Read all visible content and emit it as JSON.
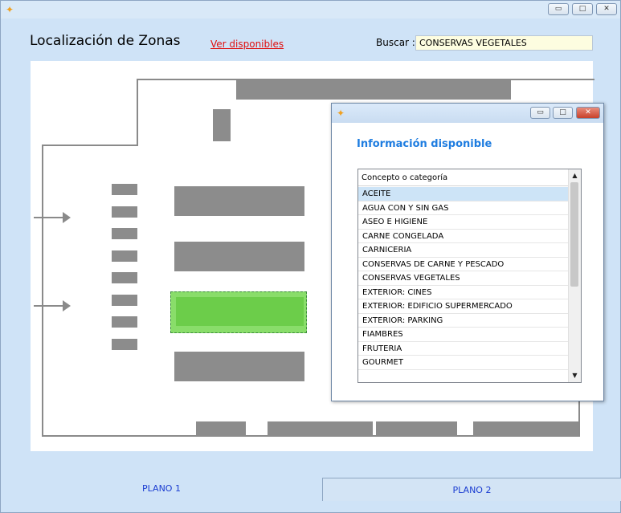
{
  "window": {
    "app_icon": "logo-bird-icon",
    "minimize": "▭",
    "maximize": "□",
    "close": "✕"
  },
  "header": {
    "title": "Localización de Zonas",
    "link_label": "Ver disponibles",
    "search_label": "Buscar :",
    "search_value": "CONSERVAS VEGETALES"
  },
  "tabs": [
    {
      "label": "PLANO 1"
    },
    {
      "label": "PLANO 2"
    }
  ],
  "popup": {
    "heading": "Información disponible",
    "list_header": "Concepto o categoría",
    "items": [
      "ACEITE",
      "AGUA CON Y SIN GAS",
      "ASEO E HIGIENE",
      "CARNE CONGELADA",
      "CARNICERIA",
      "CONSERVAS DE CARNE Y PESCADO",
      "CONSERVAS VEGETALES",
      "EXTERIOR: CINES",
      "EXTERIOR: EDIFICIO SUPERMERCADO",
      "EXTERIOR: PARKING",
      "FIAMBRES",
      "FRUTERIA",
      "GOURMET"
    ],
    "selected_index": 0,
    "scroll_up": "▲",
    "scroll_down": "▼"
  },
  "colors": {
    "accent": "#1f7de0",
    "highlight_zone": "#6ccd4a",
    "link": "#e01010"
  }
}
